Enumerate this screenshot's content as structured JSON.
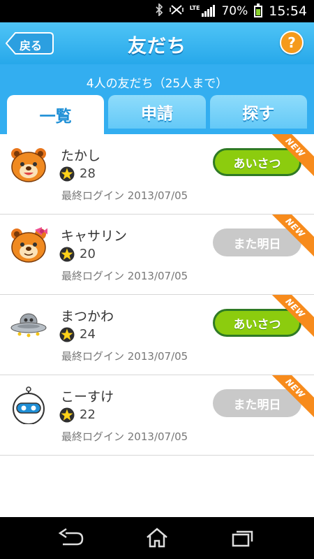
{
  "status_bar": {
    "battery": "70%",
    "time": "15:54",
    "network": "LTE",
    "icons": [
      "bluetooth-icon",
      "vibrate-icon",
      "signal-icon",
      "battery-icon"
    ]
  },
  "header": {
    "back_label": "戻る",
    "title": "友だち",
    "help_label": "?"
  },
  "friend_count": "4人の友だち（25人まで）",
  "tabs": [
    {
      "label": "一覧",
      "active": true
    },
    {
      "label": "申請",
      "active": false
    },
    {
      "label": "探す",
      "active": false
    }
  ],
  "friends": [
    {
      "name": "たかし",
      "points": "28",
      "last_login": "最終ログイン 2013/07/05",
      "action": "あいさつ",
      "action_enabled": true,
      "badge": "NEW",
      "avatar": "bear-icon"
    },
    {
      "name": "キャサリン",
      "points": "20",
      "last_login": "最終ログイン 2013/07/05",
      "action": "また明日",
      "action_enabled": false,
      "badge": "NEW",
      "avatar": "bear-bow-icon"
    },
    {
      "name": "まつかわ",
      "points": "24",
      "last_login": "最終ログイン 2013/07/05",
      "action": "あいさつ",
      "action_enabled": true,
      "badge": "NEW",
      "avatar": "ufo-icon"
    },
    {
      "name": "こーすけ",
      "points": "22",
      "last_login": "最終ログイン 2013/07/05",
      "action": "また明日",
      "action_enabled": false,
      "badge": "NEW",
      "avatar": "robot-icon"
    }
  ],
  "colors": {
    "header": "#33aef0",
    "action_on": "#8ccc0e",
    "action_off": "#c9c9c9",
    "badge": "#f78b1c",
    "help": "#f59a1c"
  }
}
